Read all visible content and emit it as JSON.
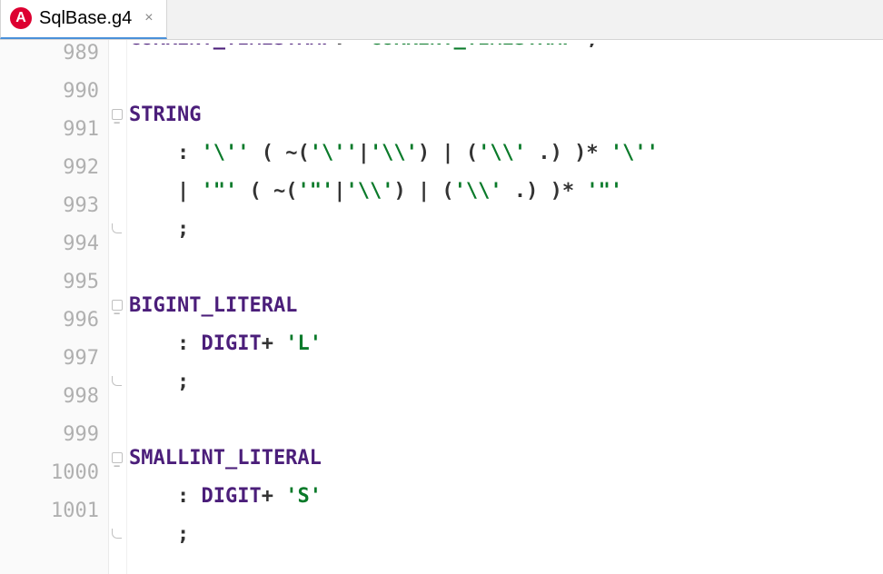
{
  "tab": {
    "iconLetter": "A",
    "title": "SqlBase.g4",
    "close": "×"
  },
  "gutter": [
    "989",
    "990",
    "991",
    "992",
    "993",
    "994",
    "995",
    "996",
    "997",
    "998",
    "999",
    "1000",
    "1001"
  ],
  "rows": [
    {
      "fold": "blank",
      "segs": []
    },
    {
      "fold": "start",
      "segs": [
        {
          "cls": "tok-ident",
          "txt": "STRING"
        }
      ]
    },
    {
      "fold": "blank",
      "segs": [
        {
          "cls": "tok-sym",
          "txt": "    : "
        },
        {
          "cls": "tok-str",
          "txt": "'\\''"
        },
        {
          "cls": "tok-sym",
          "txt": " ( ~("
        },
        {
          "cls": "tok-str",
          "txt": "'\\''"
        },
        {
          "cls": "tok-sym",
          "txt": "|"
        },
        {
          "cls": "tok-str",
          "txt": "'\\\\'"
        },
        {
          "cls": "tok-sym",
          "txt": ") | ("
        },
        {
          "cls": "tok-str",
          "txt": "'\\\\'"
        },
        {
          "cls": "tok-sym",
          "txt": " .) )* "
        },
        {
          "cls": "tok-str",
          "txt": "'\\''"
        }
      ]
    },
    {
      "fold": "blank",
      "segs": [
        {
          "cls": "tok-sym",
          "txt": "    | "
        },
        {
          "cls": "tok-str",
          "txt": "'\"'"
        },
        {
          "cls": "tok-sym",
          "txt": " ( ~("
        },
        {
          "cls": "tok-str",
          "txt": "'\"'"
        },
        {
          "cls": "tok-sym",
          "txt": "|"
        },
        {
          "cls": "tok-str",
          "txt": "'\\\\'"
        },
        {
          "cls": "tok-sym",
          "txt": ") | ("
        },
        {
          "cls": "tok-str",
          "txt": "'\\\\'"
        },
        {
          "cls": "tok-sym",
          "txt": " .) )* "
        },
        {
          "cls": "tok-str",
          "txt": "'\"'"
        }
      ]
    },
    {
      "fold": "end",
      "segs": [
        {
          "cls": "tok-sym",
          "txt": "    ;"
        }
      ]
    },
    {
      "fold": "blank",
      "segs": []
    },
    {
      "fold": "start",
      "segs": [
        {
          "cls": "tok-ident",
          "txt": "BIGINT_LITERAL"
        }
      ]
    },
    {
      "fold": "blank",
      "segs": [
        {
          "cls": "tok-sym",
          "txt": "    : "
        },
        {
          "cls": "tok-ident",
          "txt": "DIGIT"
        },
        {
          "cls": "tok-sym",
          "txt": "+ "
        },
        {
          "cls": "tok-str",
          "txt": "'L'"
        }
      ]
    },
    {
      "fold": "end",
      "segs": [
        {
          "cls": "tok-sym",
          "txt": "    ;"
        }
      ]
    },
    {
      "fold": "blank",
      "segs": []
    },
    {
      "fold": "start",
      "segs": [
        {
          "cls": "tok-ident",
          "txt": "SMALLINT_LITERAL"
        }
      ]
    },
    {
      "fold": "blank",
      "segs": [
        {
          "cls": "tok-sym",
          "txt": "    : "
        },
        {
          "cls": "tok-ident",
          "txt": "DIGIT"
        },
        {
          "cls": "tok-sym",
          "txt": "+ "
        },
        {
          "cls": "tok-str",
          "txt": "'S'"
        }
      ]
    },
    {
      "fold": "end",
      "segs": [
        {
          "cls": "tok-sym",
          "txt": "    ;"
        }
      ]
    }
  ],
  "cutoffRow": {
    "segs": [
      {
        "cls": "tok-ident",
        "txt": "CURRENT_TIMESTAMP"
      },
      {
        "cls": "tok-sym",
        "txt": ": "
      },
      {
        "cls": "tok-str",
        "txt": "'CURRENT_TIMESTAMP'"
      },
      {
        "cls": "tok-sym",
        "txt": ";"
      }
    ]
  }
}
